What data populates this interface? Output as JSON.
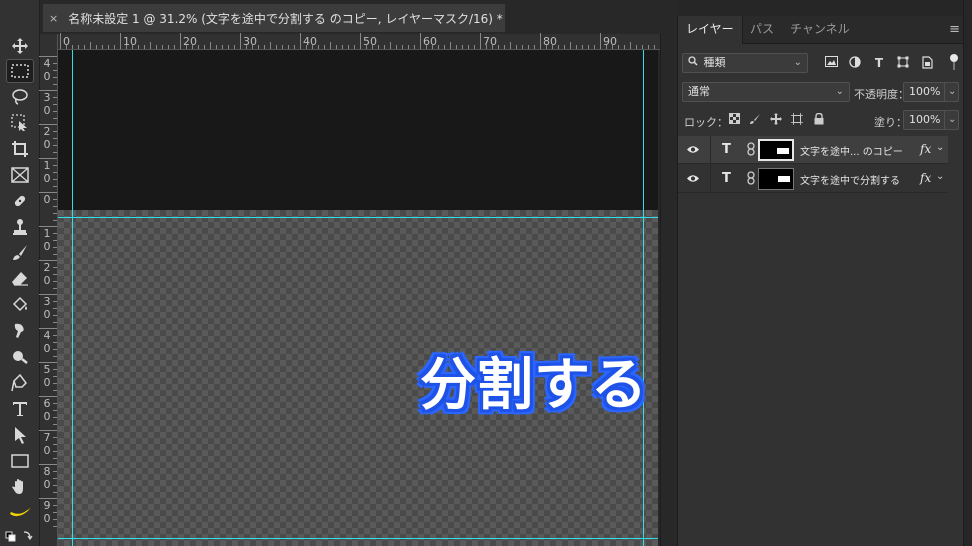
{
  "document": {
    "tab_close": "×",
    "tab_title": "名称未設定 1 @ 31.2% (文字を途中で分割する のコピー, レイヤーマスク/16) *"
  },
  "toolbar": {
    "tools": [
      {
        "name": "move-tool",
        "glyph": "✥"
      },
      {
        "name": "marquee-tool",
        "glyph": "⬚"
      },
      {
        "name": "lasso-tool",
        "glyph": "◌"
      },
      {
        "name": "object-select-tool",
        "glyph": "⬚"
      },
      {
        "name": "crop-tool",
        "glyph": "⌗"
      },
      {
        "name": "frame-tool",
        "glyph": "⊠"
      },
      {
        "name": "healing-brush-tool",
        "glyph": "✚"
      },
      {
        "name": "stamp-tool",
        "glyph": "♟"
      },
      {
        "name": "brush-tool",
        "glyph": "✎"
      },
      {
        "name": "eraser-tool",
        "glyph": "◆"
      },
      {
        "name": "paint-bucket-tool",
        "glyph": "◈"
      },
      {
        "name": "smudge-tool",
        "glyph": "☝"
      },
      {
        "name": "dodge-tool",
        "glyph": "●"
      },
      {
        "name": "pen-tool",
        "glyph": "✒"
      },
      {
        "name": "type-tool",
        "glyph": "T"
      },
      {
        "name": "path-select-tool",
        "glyph": "➤"
      },
      {
        "name": "rectangle-tool",
        "glyph": "▭"
      },
      {
        "name": "hand-tool",
        "glyph": "✋"
      },
      {
        "name": "banana-tool",
        "glyph": "🍌"
      }
    ]
  },
  "rulers": {
    "horizontal": [
      "0",
      "10",
      "20",
      "30",
      "40",
      "50",
      "60",
      "70",
      "80",
      "90"
    ],
    "vertical": [
      {
        "top": "4",
        "bottom": "0"
      },
      {
        "top": "3",
        "bottom": "0"
      },
      {
        "top": "2",
        "bottom": "0"
      },
      {
        "top": "1",
        "bottom": "0"
      },
      {
        "top": "0",
        "bottom": ""
      },
      {
        "top": "1",
        "bottom": "0"
      },
      {
        "top": "2",
        "bottom": "0"
      },
      {
        "top": "3",
        "bottom": "0"
      },
      {
        "top": "4",
        "bottom": "0"
      },
      {
        "top": "5",
        "bottom": "0"
      },
      {
        "top": "6",
        "bottom": "0"
      },
      {
        "top": "7",
        "bottom": "0"
      },
      {
        "top": "8",
        "bottom": "0"
      },
      {
        "top": "9",
        "bottom": "0"
      }
    ]
  },
  "canvas": {
    "text": "分割する",
    "text_color": "#ffffff",
    "stroke_color": "#1f52e6",
    "guide_color": "#2fe0e6"
  },
  "panel": {
    "tabs": [
      "レイヤー",
      "パス",
      "チャンネル"
    ],
    "menu_icon": "≡",
    "filter_kind": "種類",
    "filter_search_icon": "🔍",
    "filter_icons": [
      "image-filter-icon",
      "adjustment-filter-icon",
      "type-filter-icon",
      "shape-filter-icon",
      "smart-object-filter-icon"
    ],
    "blend_mode": "通常",
    "opacity_label": "不透明度：",
    "opacity_value": "100%",
    "lock_label": "ロック：",
    "fill_label": "塗り：",
    "fill_value": "100%",
    "layers": [
      {
        "name": "文字を途中... のコピー",
        "type_glyph": "T",
        "fx": "fx",
        "selected": true
      },
      {
        "name": "文字を途中で分割する",
        "type_glyph": "T",
        "fx": "fx",
        "selected": false
      }
    ]
  }
}
